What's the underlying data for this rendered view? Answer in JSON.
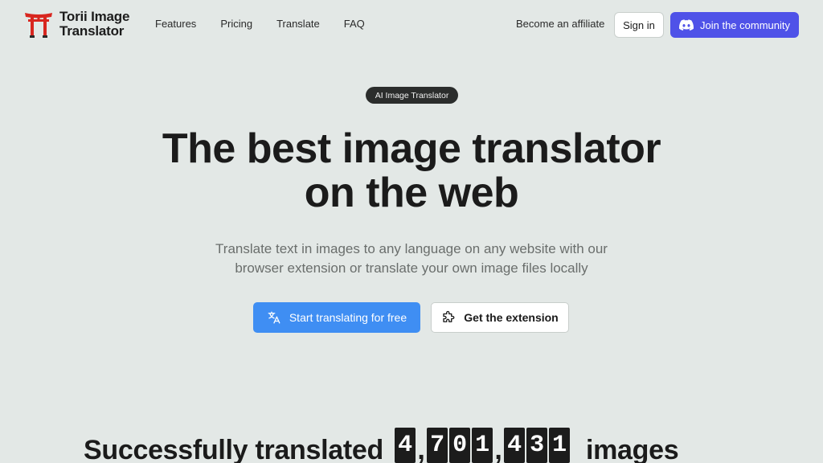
{
  "brand": {
    "line1": "Torii Image",
    "line2": "Translator"
  },
  "nav": {
    "links": [
      "Features",
      "Pricing",
      "Translate",
      "FAQ"
    ],
    "affiliate": "Become an affiliate",
    "sign_in": "Sign in",
    "join": "Join the community"
  },
  "hero": {
    "pill": "AI Image Translator",
    "headline_line1": "The best image translator",
    "headline_line2": "on the web",
    "sub_line1": "Translate text in images to any language on any website with our",
    "sub_line2": "browser extension or translate your own image files locally",
    "primary_cta": "Start translating for free",
    "secondary_cta": "Get the extension"
  },
  "counter": {
    "label": "Successfully translated",
    "digits": [
      "4",
      ",",
      "7",
      "0",
      "1",
      ",",
      "4",
      "3",
      "1"
    ],
    "suffix": "images"
  },
  "colors": {
    "background": "#e3e8e6",
    "brand_red": "#d8261f",
    "discord": "#4f52e8",
    "primary": "#3f8ef3"
  },
  "icons": {
    "logo": "torii-gate-icon",
    "join": "discord-icon",
    "primary_cta": "translate-icon",
    "secondary_cta": "puzzle-icon"
  }
}
